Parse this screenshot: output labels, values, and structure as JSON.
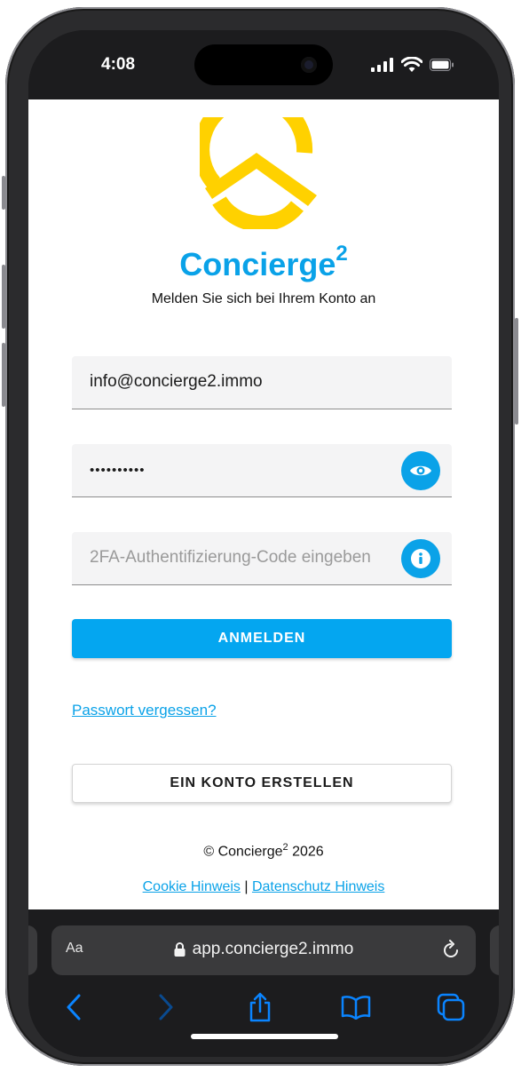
{
  "status_bar": {
    "time": "4:08",
    "icons": [
      "cellular-signal-icon",
      "wifi-icon",
      "battery-icon"
    ]
  },
  "app": {
    "brand_name": "Concierge",
    "brand_superscript": "2",
    "subtitle": "Melden Sie sich bei Ihrem Konto an",
    "brand_color": "#0aa2e8",
    "logo_color": "#ffd100"
  },
  "form": {
    "email_value": "info@concierge2.immo",
    "password_value": "••••••••••",
    "twofa_placeholder": "2FA-Authentifizierung-Code eingeben",
    "show_password_icon": "eye-icon",
    "twofa_info_icon": "info-icon",
    "login_label": "ANMELDEN",
    "forgot_label": "Passwort vergessen?",
    "create_account_label": "EIN KONTO ERSTELLEN"
  },
  "footer": {
    "copyright_prefix": "© Concierge",
    "copyright_sup": "2",
    "copyright_year": " 2026",
    "cookie_label": "Cookie Hinweis",
    "separator": "|",
    "privacy_label": "Datenschutz Hinweis"
  },
  "browser": {
    "aa_label": "Aa",
    "url": "app.concierge2.immo",
    "toolbar_icons": [
      "back-icon",
      "forward-icon",
      "share-icon",
      "bookmarks-icon",
      "tabs-icon"
    ],
    "accent_color": "#0a84ff"
  }
}
